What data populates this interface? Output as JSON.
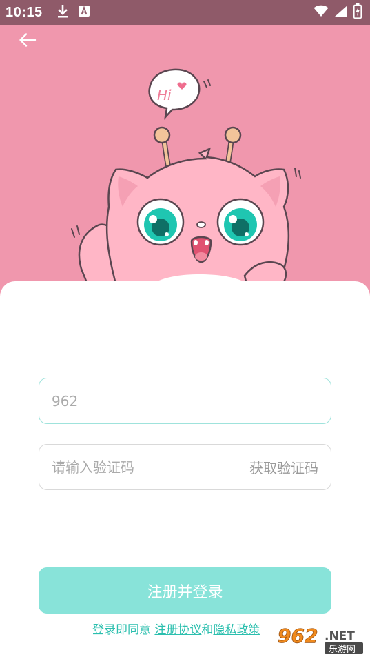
{
  "status_bar": {
    "time": "10:15",
    "icons": [
      "download-icon",
      "a-box-icon",
      "wifi-icon",
      "signal-icon",
      "battery-icon"
    ]
  },
  "header": {
    "back_icon": "arrow-left-icon",
    "illustration": {
      "speech_bubble_text": "Hi"
    }
  },
  "form": {
    "phone": {
      "value": "962"
    },
    "code": {
      "placeholder": "请输入验证码",
      "get_code_label": "获取验证码"
    },
    "submit_label": "注册并登录",
    "agreement": {
      "prefix": "登录即同意",
      "terms_link": "注册协议",
      "conjunction": "和",
      "privacy_link": "隐私政策"
    }
  },
  "watermark": {
    "number": "962",
    "suffix": ".NET",
    "sub": "乐游网"
  },
  "colors": {
    "hero_bg": "#f097ad",
    "status_bg": "#8f5a69",
    "accent": "#88e3d9",
    "link": "#2bbfae",
    "watermark_orange": "#f08a1d"
  }
}
